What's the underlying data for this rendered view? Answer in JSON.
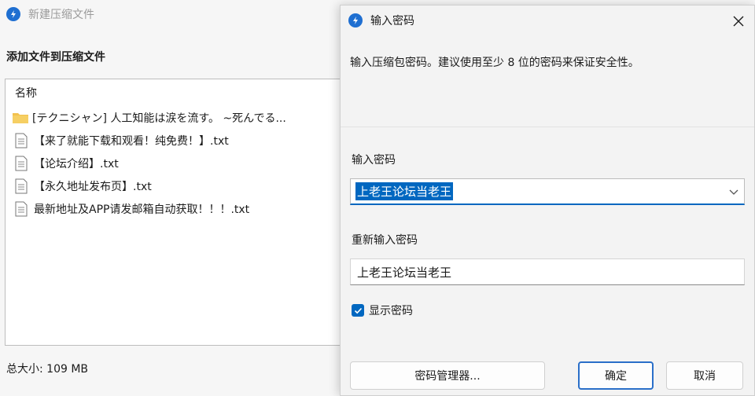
{
  "background_window": {
    "title": "新建压缩文件",
    "section_title": "添加文件到压缩文件",
    "file_list": {
      "header": "名称",
      "items": [
        {
          "type": "folder",
          "name": "[テクニシャン] 人工知能は涙を流す。 ~死んでる..."
        },
        {
          "type": "file",
          "name": "【来了就能下载和观看！纯免费！】.txt"
        },
        {
          "type": "file",
          "name": "【论坛介绍】.txt"
        },
        {
          "type": "file",
          "name": "【永久地址发布页】.txt"
        },
        {
          "type": "file",
          "name": "最新地址及APP请发邮箱自动获取！！！.txt"
        }
      ]
    },
    "total_size": "总大小: 109 MB"
  },
  "dialog": {
    "title": "输入密码",
    "description": "输入压缩包密码。建议使用至少 8 位的密码来保证安全性。",
    "password_label": "输入密码",
    "password_value": "上老王论坛当老王",
    "reenter_label": "重新输入密码",
    "reenter_value": "上老王论坛当老王",
    "show_password_label": "显示密码",
    "show_password_checked": true,
    "buttons": {
      "manager": "密码管理器...",
      "ok": "确定",
      "cancel": "取消"
    }
  },
  "colors": {
    "accent": "#0067c0",
    "app_icon": "#1f6fd1",
    "folder": "#f2c14e"
  }
}
